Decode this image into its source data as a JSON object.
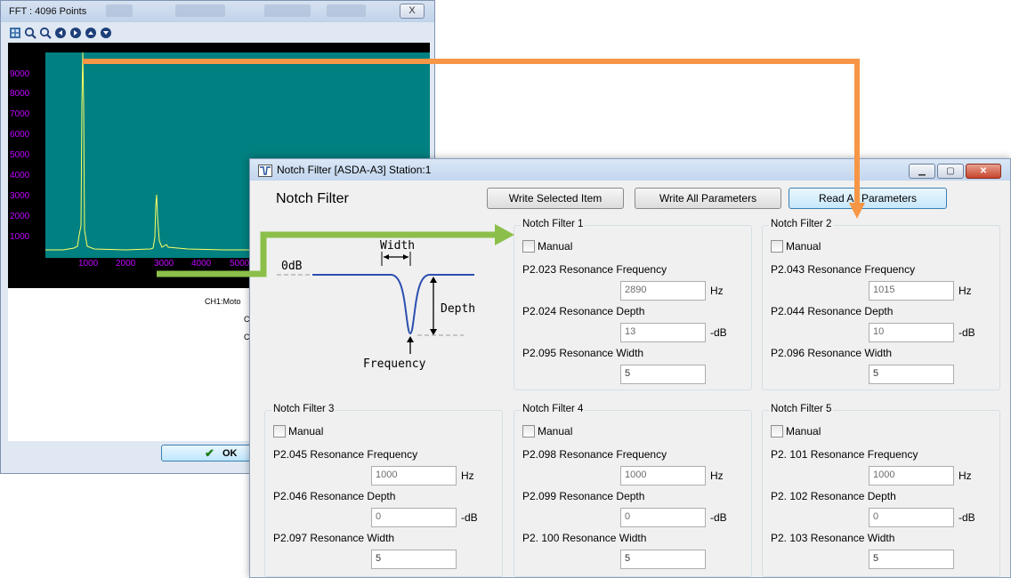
{
  "fft": {
    "title": "FFT : 4096 Points",
    "close_glyph": "X",
    "toolbar_icons": [
      "fit-icon",
      "zoom-in-icon",
      "zoom-out-icon",
      "pan-left-icon",
      "pan-right-icon",
      "pan-up-icon",
      "pan-down-icon"
    ],
    "plot_bg": "#008080",
    "trace_color": "#ffff66",
    "tick_color": "#c000ff",
    "y_ticks": [
      "9000",
      "8000",
      "7000",
      "6000",
      "5000",
      "4000",
      "3000",
      "2000",
      "1000"
    ],
    "x_ticks": [
      "1000",
      "2000",
      "3000",
      "4000",
      "5000"
    ],
    "info_lines": [
      "CH1:Moto",
      "C",
      "C"
    ],
    "ok_label": "OK"
  },
  "notch": {
    "window_title": "Notch Filter [ASDA-A3] Station:1",
    "heading": "Notch Filter",
    "buttons": {
      "write_selected": "Write Selected Item",
      "write_all": "Write All Parameters",
      "read_all": "Read All Parameters"
    },
    "diagram": {
      "width_label": "Width",
      "zero_db_label": "0dB",
      "depth_label": "Depth",
      "frequency_label": "Frequency"
    },
    "filters": [
      {
        "title": "Notch Filter 1",
        "manual": "Manual",
        "freq_label": "P2.023 Resonance Frequency",
        "freq": "2890",
        "freq_unit": "Hz",
        "depth_label": "P2.024 Resonance Depth",
        "depth": "13",
        "depth_unit": "-dB",
        "width_label": "P2.095 Resonance Width",
        "width": "5"
      },
      {
        "title": "Notch Filter 2",
        "manual": "Manual",
        "freq_label": "P2.043 Resonance Frequency",
        "freq": "1015",
        "freq_unit": "Hz",
        "depth_label": "P2.044 Resonance Depth",
        "depth": "10",
        "depth_unit": "-dB",
        "width_label": "P2.096 Resonance Width",
        "width": "5"
      },
      {
        "title": "Notch Filter 3",
        "manual": "Manual",
        "freq_label": "P2.045 Resonance Frequency",
        "freq": "1000",
        "freq_unit": "Hz",
        "depth_label": "P2.046 Resonance Depth",
        "depth": "0",
        "depth_unit": "-dB",
        "width_label": "P2.097 Resonance Width",
        "width": "5"
      },
      {
        "title": "Notch Filter 4",
        "manual": "Manual",
        "freq_label": "P2.098 Resonance Frequency",
        "freq": "1000",
        "freq_unit": "Hz",
        "depth_label": "P2.099 Resonance Depth",
        "depth": "0",
        "depth_unit": "-dB",
        "width_label": "P2. 100 Resonance Width",
        "width": "5"
      },
      {
        "title": "Notch Filter 5",
        "manual": "Manual",
        "freq_label": "P2. 101 Resonance Frequency",
        "freq": "1000",
        "freq_unit": "Hz",
        "depth_label": "P2. 102 Resonance Depth",
        "depth": "0",
        "depth_unit": "-dB",
        "width_label": "P2. 103 Resonance Width",
        "width": "5"
      }
    ]
  },
  "annotation_colors": {
    "orange": "#f79646",
    "green": "#8cbf4a"
  }
}
